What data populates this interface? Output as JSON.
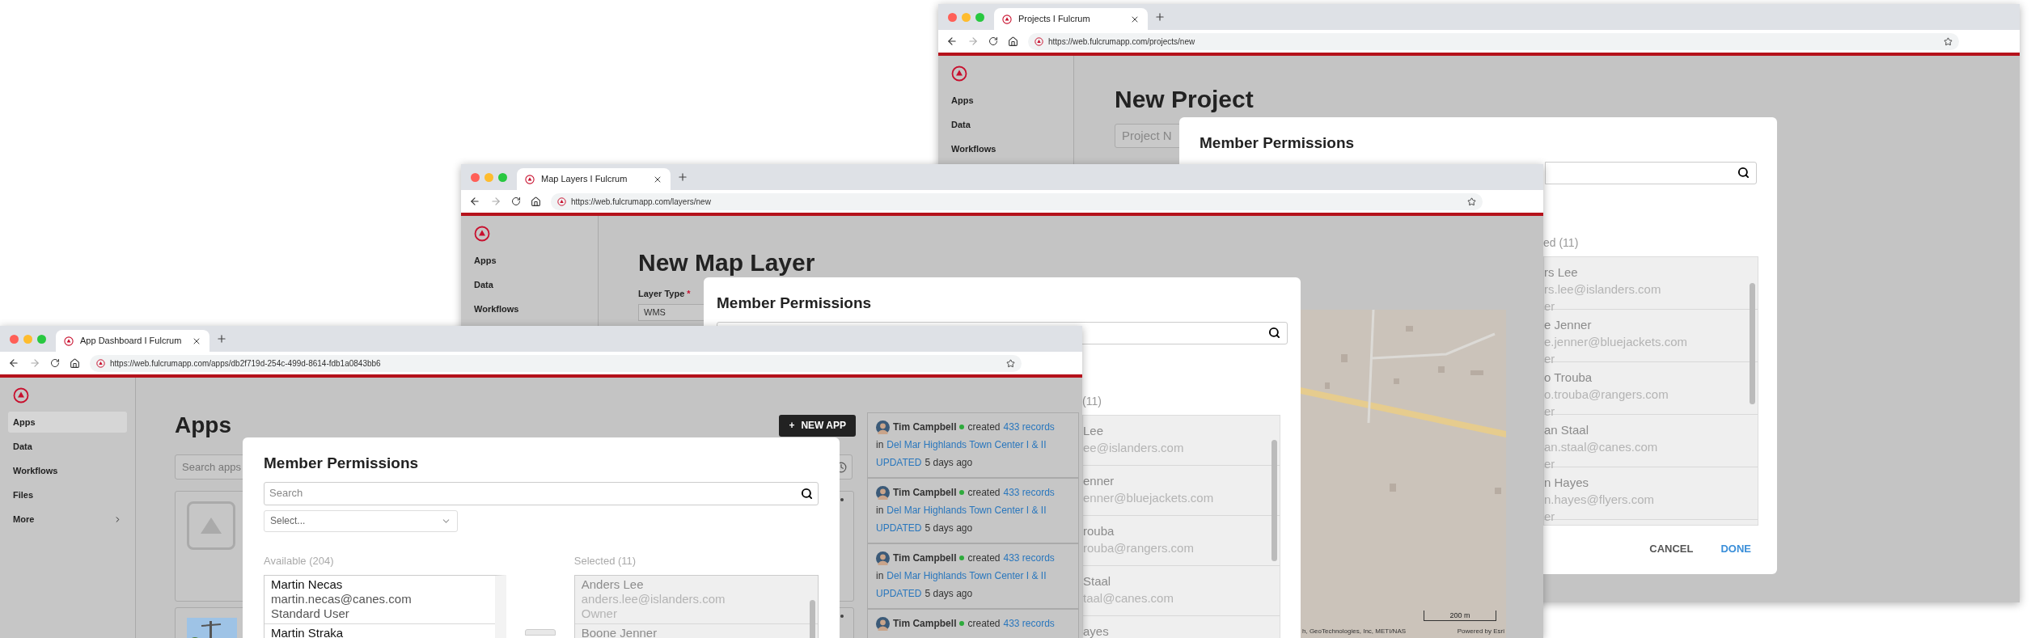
{
  "projects_window": {
    "tab_title": "Projects I Fulcrum",
    "url": "https://web.fulcrumapp.com/projects/new",
    "sidebar_items": [
      {
        "label": "Apps",
        "selected": false
      },
      {
        "label": "Data",
        "selected": false
      },
      {
        "label": "Workflows",
        "selected": false
      }
    ],
    "page_title": "New Project",
    "name_field": {
      "placeholder": "Project N"
    },
    "modal": {
      "title": "Member Permissions",
      "selected_heading": "ed (11)",
      "selected_members": [
        {
          "name": "rs Lee",
          "email": "rs.lee@islanders.com",
          "role": "er"
        },
        {
          "name": "e Jenner",
          "email": "e.jenner@bluejackets.com",
          "role": "er"
        },
        {
          "name": "o Trouba",
          "email": "o.trouba@rangers.com",
          "role": "er"
        },
        {
          "name": "an Staal",
          "email": "an.staal@canes.com",
          "role": "er"
        },
        {
          "name": "n Hayes",
          "email": "n.hayes@flyers.com",
          "role": "er"
        }
      ],
      "buttons": [
        {
          "label": "CANCEL",
          "kind": "secondary"
        },
        {
          "label": "DONE",
          "kind": "primary"
        }
      ]
    }
  },
  "map_layers_window": {
    "tab_title": "Map Layers I Fulcrum",
    "url": "https://web.fulcrumapp.com/layers/new",
    "sidebar_items": [
      {
        "label": "Apps",
        "selected": false
      },
      {
        "label": "Data",
        "selected": false
      },
      {
        "label": "Workflows",
        "selected": false
      }
    ],
    "page_title": "New Map Layer",
    "layer_type": {
      "label": "Layer Type",
      "required_mark": "*",
      "value": "WMS"
    },
    "modal": {
      "title": "Member Permissions",
      "selected_heading": "(11)",
      "selected_members": [
        {
          "name": "Lee",
          "email": "ee@islanders.com"
        },
        {
          "name": "enner",
          "email": "enner@bluejackets.com"
        },
        {
          "name": "rouba",
          "email": "rouba@rangers.com"
        },
        {
          "name": "Staal",
          "email": "taal@canes.com"
        },
        {
          "name": "ayes"
        }
      ]
    },
    "map": {
      "scale": "200 m",
      "attribution": "h, GeoTechnologies, Inc, METI/NAS",
      "credit": "Powered by Esri"
    }
  },
  "app_dashboard_window": {
    "tab_title": "App Dashboard I Fulcrum",
    "url": "https://web.fulcrumapp.com/apps/db2f719d-254c-499d-8614-fdb1a0843bb6",
    "sidebar_items": [
      {
        "label": "Apps",
        "selected": true,
        "kind": "link"
      },
      {
        "label": "Data",
        "selected": false,
        "kind": "link"
      },
      {
        "label": "Workflows",
        "selected": false,
        "kind": "link"
      },
      {
        "label": "Files",
        "selected": false,
        "kind": "link"
      },
      {
        "label": "More",
        "selected": false,
        "kind": "submenu"
      }
    ],
    "page_title": "Apps",
    "new_app_button": {
      "icon": "+",
      "label": "NEW APP"
    },
    "search": {
      "placeholder": "Search apps"
    },
    "modal": {
      "title": "Member Permissions",
      "search": {
        "placeholder": "Search"
      },
      "role_select": {
        "placeholder": "Select..."
      },
      "available_heading": "Available (204)",
      "available_members": [
        {
          "name": "Martin Necas",
          "email": "martin.necas@canes.com",
          "role": "Standard User"
        },
        {
          "name": "Martin Straka"
        }
      ],
      "selected_heading": "Selected (11)",
      "selected_members": [
        {
          "name": "Anders Lee",
          "email": "anders.lee@islanders.com",
          "role": "Owner"
        },
        {
          "name": "Boone Jenner"
        }
      ]
    },
    "activity": [
      {
        "user": "Tim Campbell",
        "action": "created",
        "count_link": "433 records",
        "preposition": "in",
        "project": "Del Mar Highlands Town Center I & II",
        "status": "UPDATED",
        "time": "5 days ago"
      },
      {
        "user": "Tim Campbell",
        "action": "created",
        "count_link": "433 records",
        "preposition": "in",
        "project": "Del Mar Highlands Town Center I & II",
        "status": "UPDATED",
        "time": "5 days ago"
      },
      {
        "user": "Tim Campbell",
        "action": "created",
        "count_link": "433 records",
        "preposition": "in",
        "project": "Del Mar Highlands Town Center I & II",
        "status": "UPDATED",
        "time": "5 days ago"
      },
      {
        "user": "Tim Campbell",
        "action": "created",
        "count_link": "433 records"
      }
    ]
  }
}
